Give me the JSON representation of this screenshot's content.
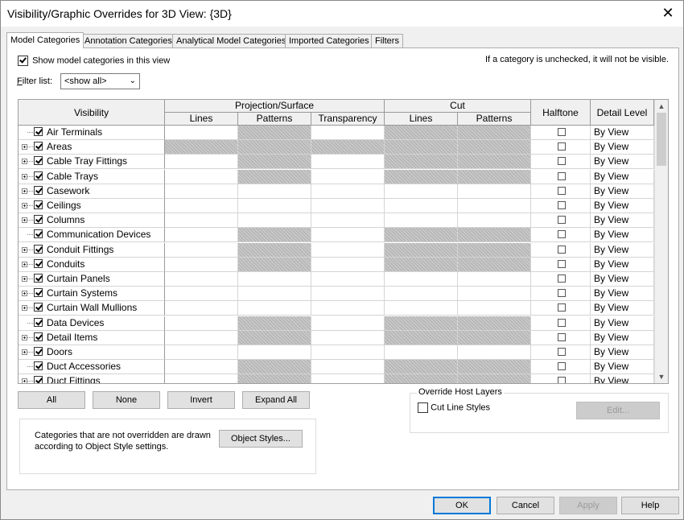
{
  "window": {
    "title": "Visibility/Graphic Overrides for 3D View: {3D}",
    "close_glyph": "✕"
  },
  "tabs": [
    {
      "label": "Model Categories",
      "active": true
    },
    {
      "label": "Annotation Categories"
    },
    {
      "label": "Analytical Model Categories"
    },
    {
      "label": "Imported Categories"
    },
    {
      "label": "Filters"
    }
  ],
  "show_categories": {
    "label": "Show model categories in this view",
    "checked": true
  },
  "hint": "If a category is unchecked, it will not be visible.",
  "filter": {
    "label": "Filter list:",
    "value": "<show all>"
  },
  "grid": {
    "headers": {
      "visibility": "Visibility",
      "projection_surface": "Projection/Surface",
      "cut": "Cut",
      "halftone": "Halftone",
      "detail_level": "Detail Level",
      "lines": "Lines",
      "patterns": "Patterns",
      "transparency": "Transparency",
      "cut_lines": "Lines",
      "cut_patterns": "Patterns"
    },
    "rows": [
      {
        "name": "Air Terminals",
        "expandable": false,
        "hatch": [
          0,
          1,
          0,
          1,
          1
        ],
        "detail": "By View"
      },
      {
        "name": "Areas",
        "expandable": true,
        "hatch": [
          1,
          1,
          1,
          1,
          1
        ],
        "detail": "By View"
      },
      {
        "name": "Cable Tray Fittings",
        "expandable": true,
        "hatch": [
          0,
          1,
          0,
          1,
          1
        ],
        "detail": "By View"
      },
      {
        "name": "Cable Trays",
        "expandable": true,
        "hatch": [
          0,
          1,
          0,
          1,
          1
        ],
        "detail": "By View"
      },
      {
        "name": "Casework",
        "expandable": true,
        "hatch": [
          0,
          0,
          0,
          0,
          0
        ],
        "detail": "By View"
      },
      {
        "name": "Ceilings",
        "expandable": true,
        "hatch": [
          0,
          0,
          0,
          0,
          0
        ],
        "detail": "By View"
      },
      {
        "name": "Columns",
        "expandable": true,
        "hatch": [
          0,
          0,
          0,
          0,
          0
        ],
        "detail": "By View"
      },
      {
        "name": "Communication Devices",
        "expandable": false,
        "hatch": [
          0,
          1,
          0,
          1,
          1
        ],
        "detail": "By View"
      },
      {
        "name": "Conduit Fittings",
        "expandable": true,
        "hatch": [
          0,
          1,
          0,
          1,
          1
        ],
        "detail": "By View"
      },
      {
        "name": "Conduits",
        "expandable": true,
        "hatch": [
          0,
          1,
          0,
          1,
          1
        ],
        "detail": "By View"
      },
      {
        "name": "Curtain Panels",
        "expandable": true,
        "hatch": [
          0,
          0,
          0,
          0,
          0
        ],
        "detail": "By View"
      },
      {
        "name": "Curtain Systems",
        "expandable": true,
        "hatch": [
          0,
          0,
          0,
          0,
          0
        ],
        "detail": "By View"
      },
      {
        "name": "Curtain Wall Mullions",
        "expandable": true,
        "hatch": [
          0,
          0,
          0,
          0,
          0
        ],
        "detail": "By View"
      },
      {
        "name": "Data Devices",
        "expandable": false,
        "hatch": [
          0,
          1,
          0,
          1,
          1
        ],
        "detail": "By View"
      },
      {
        "name": "Detail Items",
        "expandable": true,
        "hatch": [
          0,
          1,
          0,
          1,
          1
        ],
        "detail": "By View"
      },
      {
        "name": "Doors",
        "expandable": true,
        "hatch": [
          0,
          0,
          0,
          0,
          0
        ],
        "detail": "By View"
      },
      {
        "name": "Duct Accessories",
        "expandable": false,
        "hatch": [
          0,
          1,
          0,
          1,
          1
        ],
        "detail": "By View"
      },
      {
        "name": "Duct Fittings",
        "expandable": true,
        "hatch": [
          0,
          1,
          0,
          1,
          1
        ],
        "detail": "By View"
      }
    ]
  },
  "buttons": {
    "all": "All",
    "none": "None",
    "invert": "Invert",
    "expand_all": "Expand All",
    "object_styles": "Object Styles...",
    "edit": "Edit...",
    "ok": "OK",
    "cancel": "Cancel",
    "apply": "Apply",
    "help": "Help"
  },
  "note": "Categories that are not overridden are drawn according to Object Style settings.",
  "override_host": {
    "title": "Override Host Layers",
    "cut_line_styles": "Cut Line Styles",
    "checked": false
  }
}
